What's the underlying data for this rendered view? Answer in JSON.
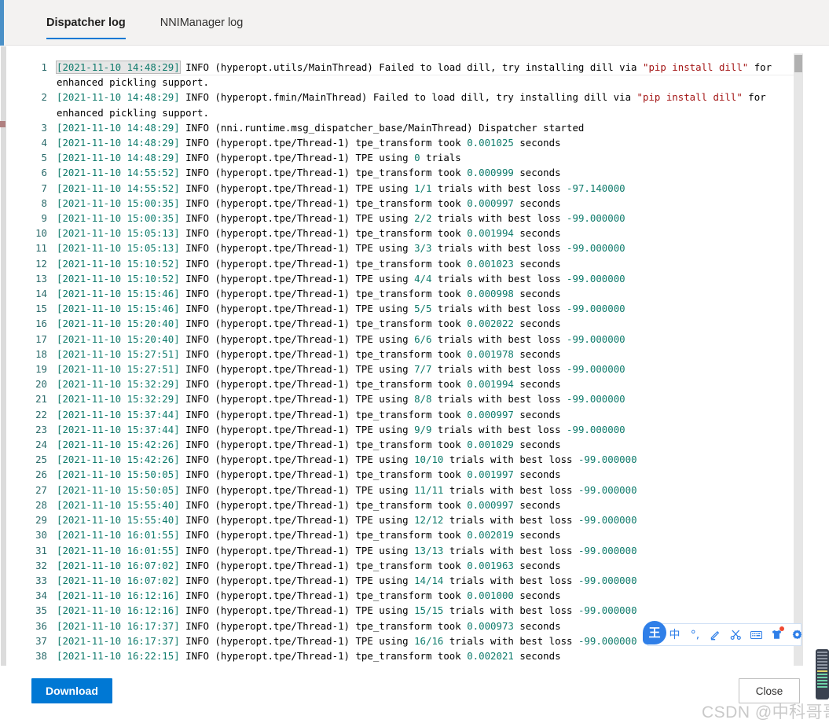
{
  "header": {
    "tabs": [
      {
        "label": "Dispatcher log",
        "active": true
      },
      {
        "label": "NNIManager log",
        "active": false
      }
    ]
  },
  "colors": {
    "accent": "#0078d4",
    "header_rail": "#4a90c7",
    "token_number": "#0f7b6c",
    "token_string": "#a31515",
    "line_number": "#2b6b6b",
    "ime_blue": "#2f7fe8",
    "badge_red": "#f04a32"
  },
  "log": {
    "lines": [
      {
        "n": "1",
        "ts": "[2021-11-10 14:48:29]",
        "ts_selected": true,
        "mid": " INFO (hyperopt.utils/MainThread) Failed to load dill, try installing dill via ",
        "str": "\"pip install dill\"",
        "tail": " for enhanced pickling support.",
        "num": "",
        "post": ""
      },
      {
        "n": "2",
        "ts": "[2021-11-10 14:48:29]",
        "ts_selected": false,
        "mid": " INFO (hyperopt.fmin/MainThread) Failed to load dill, try installing dill via ",
        "str": "\"pip install dill\"",
        "tail": " for enhanced pickling support.",
        "num": "",
        "post": ""
      },
      {
        "n": "3",
        "ts": "[2021-11-10 14:48:29]",
        "ts_selected": false,
        "mid": " INFO (nni.runtime.msg_dispatcher_base/MainThread) Dispatcher started",
        "str": "",
        "tail": "",
        "num": "",
        "post": ""
      },
      {
        "n": "4",
        "ts": "[2021-11-10 14:48:29]",
        "ts_selected": false,
        "mid": " INFO (hyperopt.tpe/Thread-1) tpe_transform took ",
        "str": "",
        "tail": "",
        "num": "0.001025",
        "post": " seconds"
      },
      {
        "n": "5",
        "ts": "[2021-11-10 14:48:29]",
        "ts_selected": false,
        "mid": " INFO (hyperopt.tpe/Thread-1) TPE using ",
        "str": "",
        "tail": "",
        "num": "0",
        "post": " trials"
      },
      {
        "n": "6",
        "ts": "[2021-11-10 14:55:52]",
        "ts_selected": false,
        "mid": " INFO (hyperopt.tpe/Thread-1) tpe_transform took ",
        "str": "",
        "tail": "",
        "num": "0.000999",
        "post": " seconds"
      },
      {
        "n": "7",
        "ts": "[2021-11-10 14:55:52]",
        "ts_selected": false,
        "mid": " INFO (hyperopt.tpe/Thread-1) TPE using ",
        "str": "",
        "tail": "",
        "num": "1/1",
        "post": " trials with best loss ",
        "num2": "-97.140000"
      },
      {
        "n": "8",
        "ts": "[2021-11-10 15:00:35]",
        "ts_selected": false,
        "mid": " INFO (hyperopt.tpe/Thread-1) tpe_transform took ",
        "str": "",
        "tail": "",
        "num": "0.000997",
        "post": " seconds"
      },
      {
        "n": "9",
        "ts": "[2021-11-10 15:00:35]",
        "ts_selected": false,
        "mid": " INFO (hyperopt.tpe/Thread-1) TPE using ",
        "str": "",
        "tail": "",
        "num": "2/2",
        "post": " trials with best loss ",
        "num2": "-99.000000"
      },
      {
        "n": "10",
        "ts": "[2021-11-10 15:05:13]",
        "ts_selected": false,
        "mid": " INFO (hyperopt.tpe/Thread-1) tpe_transform took ",
        "str": "",
        "tail": "",
        "num": "0.001994",
        "post": " seconds"
      },
      {
        "n": "11",
        "ts": "[2021-11-10 15:05:13]",
        "ts_selected": false,
        "mid": " INFO (hyperopt.tpe/Thread-1) TPE using ",
        "str": "",
        "tail": "",
        "num": "3/3",
        "post": " trials with best loss ",
        "num2": "-99.000000"
      },
      {
        "n": "12",
        "ts": "[2021-11-10 15:10:52]",
        "ts_selected": false,
        "mid": " INFO (hyperopt.tpe/Thread-1) tpe_transform took ",
        "str": "",
        "tail": "",
        "num": "0.001023",
        "post": " seconds"
      },
      {
        "n": "13",
        "ts": "[2021-11-10 15:10:52]",
        "ts_selected": false,
        "mid": " INFO (hyperopt.tpe/Thread-1) TPE using ",
        "str": "",
        "tail": "",
        "num": "4/4",
        "post": " trials with best loss ",
        "num2": "-99.000000"
      },
      {
        "n": "14",
        "ts": "[2021-11-10 15:15:46]",
        "ts_selected": false,
        "mid": " INFO (hyperopt.tpe/Thread-1) tpe_transform took ",
        "str": "",
        "tail": "",
        "num": "0.000998",
        "post": " seconds"
      },
      {
        "n": "15",
        "ts": "[2021-11-10 15:15:46]",
        "ts_selected": false,
        "mid": " INFO (hyperopt.tpe/Thread-1) TPE using ",
        "str": "",
        "tail": "",
        "num": "5/5",
        "post": " trials with best loss ",
        "num2": "-99.000000"
      },
      {
        "n": "16",
        "ts": "[2021-11-10 15:20:40]",
        "ts_selected": false,
        "mid": " INFO (hyperopt.tpe/Thread-1) tpe_transform took ",
        "str": "",
        "tail": "",
        "num": "0.002022",
        "post": " seconds"
      },
      {
        "n": "17",
        "ts": "[2021-11-10 15:20:40]",
        "ts_selected": false,
        "mid": " INFO (hyperopt.tpe/Thread-1) TPE using ",
        "str": "",
        "tail": "",
        "num": "6/6",
        "post": " trials with best loss ",
        "num2": "-99.000000"
      },
      {
        "n": "18",
        "ts": "[2021-11-10 15:27:51]",
        "ts_selected": false,
        "mid": " INFO (hyperopt.tpe/Thread-1) tpe_transform took ",
        "str": "",
        "tail": "",
        "num": "0.001978",
        "post": " seconds"
      },
      {
        "n": "19",
        "ts": "[2021-11-10 15:27:51]",
        "ts_selected": false,
        "mid": " INFO (hyperopt.tpe/Thread-1) TPE using ",
        "str": "",
        "tail": "",
        "num": "7/7",
        "post": " trials with best loss ",
        "num2": "-99.000000"
      },
      {
        "n": "20",
        "ts": "[2021-11-10 15:32:29]",
        "ts_selected": false,
        "mid": " INFO (hyperopt.tpe/Thread-1) tpe_transform took ",
        "str": "",
        "tail": "",
        "num": "0.001994",
        "post": " seconds"
      },
      {
        "n": "21",
        "ts": "[2021-11-10 15:32:29]",
        "ts_selected": false,
        "mid": " INFO (hyperopt.tpe/Thread-1) TPE using ",
        "str": "",
        "tail": "",
        "num": "8/8",
        "post": " trials with best loss ",
        "num2": "-99.000000"
      },
      {
        "n": "22",
        "ts": "[2021-11-10 15:37:44]",
        "ts_selected": false,
        "mid": " INFO (hyperopt.tpe/Thread-1) tpe_transform took ",
        "str": "",
        "tail": "",
        "num": "0.000997",
        "post": " seconds"
      },
      {
        "n": "23",
        "ts": "[2021-11-10 15:37:44]",
        "ts_selected": false,
        "mid": " INFO (hyperopt.tpe/Thread-1) TPE using ",
        "str": "",
        "tail": "",
        "num": "9/9",
        "post": " trials with best loss ",
        "num2": "-99.000000"
      },
      {
        "n": "24",
        "ts": "[2021-11-10 15:42:26]",
        "ts_selected": false,
        "mid": " INFO (hyperopt.tpe/Thread-1) tpe_transform took ",
        "str": "",
        "tail": "",
        "num": "0.001029",
        "post": " seconds"
      },
      {
        "n": "25",
        "ts": "[2021-11-10 15:42:26]",
        "ts_selected": false,
        "mid": " INFO (hyperopt.tpe/Thread-1) TPE using ",
        "str": "",
        "tail": "",
        "num": "10/10",
        "post": " trials with best loss ",
        "num2": "-99.000000"
      },
      {
        "n": "26",
        "ts": "[2021-11-10 15:50:05]",
        "ts_selected": false,
        "mid": " INFO (hyperopt.tpe/Thread-1) tpe_transform took ",
        "str": "",
        "tail": "",
        "num": "0.001997",
        "post": " seconds"
      },
      {
        "n": "27",
        "ts": "[2021-11-10 15:50:05]",
        "ts_selected": false,
        "mid": " INFO (hyperopt.tpe/Thread-1) TPE using ",
        "str": "",
        "tail": "",
        "num": "11/11",
        "post": " trials with best loss ",
        "num2": "-99.000000"
      },
      {
        "n": "28",
        "ts": "[2021-11-10 15:55:40]",
        "ts_selected": false,
        "mid": " INFO (hyperopt.tpe/Thread-1) tpe_transform took ",
        "str": "",
        "tail": "",
        "num": "0.000997",
        "post": " seconds"
      },
      {
        "n": "29",
        "ts": "[2021-11-10 15:55:40]",
        "ts_selected": false,
        "mid": " INFO (hyperopt.tpe/Thread-1) TPE using ",
        "str": "",
        "tail": "",
        "num": "12/12",
        "post": " trials with best loss ",
        "num2": "-99.000000"
      },
      {
        "n": "30",
        "ts": "[2021-11-10 16:01:55]",
        "ts_selected": false,
        "mid": " INFO (hyperopt.tpe/Thread-1) tpe_transform took ",
        "str": "",
        "tail": "",
        "num": "0.002019",
        "post": " seconds"
      },
      {
        "n": "31",
        "ts": "[2021-11-10 16:01:55]",
        "ts_selected": false,
        "mid": " INFO (hyperopt.tpe/Thread-1) TPE using ",
        "str": "",
        "tail": "",
        "num": "13/13",
        "post": " trials with best loss ",
        "num2": "-99.000000"
      },
      {
        "n": "32",
        "ts": "[2021-11-10 16:07:02]",
        "ts_selected": false,
        "mid": " INFO (hyperopt.tpe/Thread-1) tpe_transform took ",
        "str": "",
        "tail": "",
        "num": "0.001963",
        "post": " seconds"
      },
      {
        "n": "33",
        "ts": "[2021-11-10 16:07:02]",
        "ts_selected": false,
        "mid": " INFO (hyperopt.tpe/Thread-1) TPE using ",
        "str": "",
        "tail": "",
        "num": "14/14",
        "post": " trials with best loss ",
        "num2": "-99.000000"
      },
      {
        "n": "34",
        "ts": "[2021-11-10 16:12:16]",
        "ts_selected": false,
        "mid": " INFO (hyperopt.tpe/Thread-1) tpe_transform took ",
        "str": "",
        "tail": "",
        "num": "0.001000",
        "post": " seconds"
      },
      {
        "n": "35",
        "ts": "[2021-11-10 16:12:16]",
        "ts_selected": false,
        "mid": " INFO (hyperopt.tpe/Thread-1) TPE using ",
        "str": "",
        "tail": "",
        "num": "15/15",
        "post": " trials with best loss ",
        "num2": "-99.000000"
      },
      {
        "n": "36",
        "ts": "[2021-11-10 16:17:37]",
        "ts_selected": false,
        "mid": " INFO (hyperopt.tpe/Thread-1) tpe_transform took ",
        "str": "",
        "tail": "",
        "num": "0.000973",
        "post": " seconds"
      },
      {
        "n": "37",
        "ts": "[2021-11-10 16:17:37]",
        "ts_selected": false,
        "mid": " INFO (hyperopt.tpe/Thread-1) TPE using ",
        "str": "",
        "tail": "",
        "num": "16/16",
        "post": " trials with best loss ",
        "num2": "-99.000000"
      },
      {
        "n": "38",
        "ts": "[2021-11-10 16:22:15]",
        "ts_selected": false,
        "mid": " INFO (hyperopt.tpe/Thread-1) tpe_transform took ",
        "str": "",
        "tail": "",
        "num": "0.002021",
        "post": " seconds"
      }
    ]
  },
  "footer": {
    "download_label": "Download",
    "close_label": "Close"
  },
  "watermark": {
    "text": "CSDN @中科哥哥"
  },
  "ime": {
    "logo_label": "王",
    "items": [
      {
        "name": "language-mode-icon",
        "glyph": "中"
      },
      {
        "name": "punctuation-icon",
        "glyph": "°,"
      },
      {
        "name": "handwriting-icon",
        "glyph": "pencil"
      },
      {
        "name": "screenshot-icon",
        "glyph": "scissors"
      },
      {
        "name": "soft-keyboard-icon",
        "glyph": "keyboard"
      },
      {
        "name": "skin-icon",
        "glyph": "shirt",
        "badge": true
      },
      {
        "name": "settings-icon",
        "glyph": "gear"
      }
    ]
  }
}
